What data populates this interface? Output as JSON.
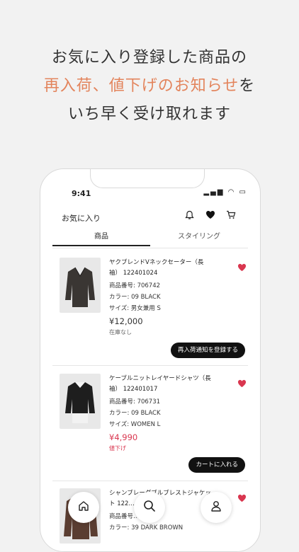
{
  "promo": {
    "line1": "お気に入り登録した商品の",
    "line2_accent": "再入荷、値下げのお知らせ",
    "line2_tail": "を",
    "line3": "いち早く受け取れます"
  },
  "status_bar": {
    "time": "9:41"
  },
  "header": {
    "title": "お気に入り"
  },
  "tabs": [
    {
      "label": "商品",
      "active": true
    },
    {
      "label": "スタイリング",
      "active": false
    }
  ],
  "products": [
    {
      "name": "ヤクブレンドVネックセーター（長袖） 122401024",
      "number": "商品番号: 706742",
      "color": "カラー: 09 BLACK",
      "size": "サイズ: 男女兼用 S",
      "price": "¥12,000",
      "status": "在庫なし",
      "action": "再入荷通知を登録する"
    },
    {
      "name": "ケーブルニットレイヤードシャツ（長袖） 122401017",
      "number": "商品番号: 706731",
      "color": "カラー: 09 BLACK",
      "size": "サイズ: WOMEN L",
      "price": "¥4,990",
      "status": "値下げ",
      "action": "カートに入れる"
    },
    {
      "name": "シャンブレーダブルブレストジャケット 122…",
      "number": "商品番号…",
      "color": "カラー: 39 DARK BROWN"
    }
  ],
  "colors": {
    "accent": "#e3845c",
    "sale": "#d9364f",
    "button": "#111111"
  }
}
